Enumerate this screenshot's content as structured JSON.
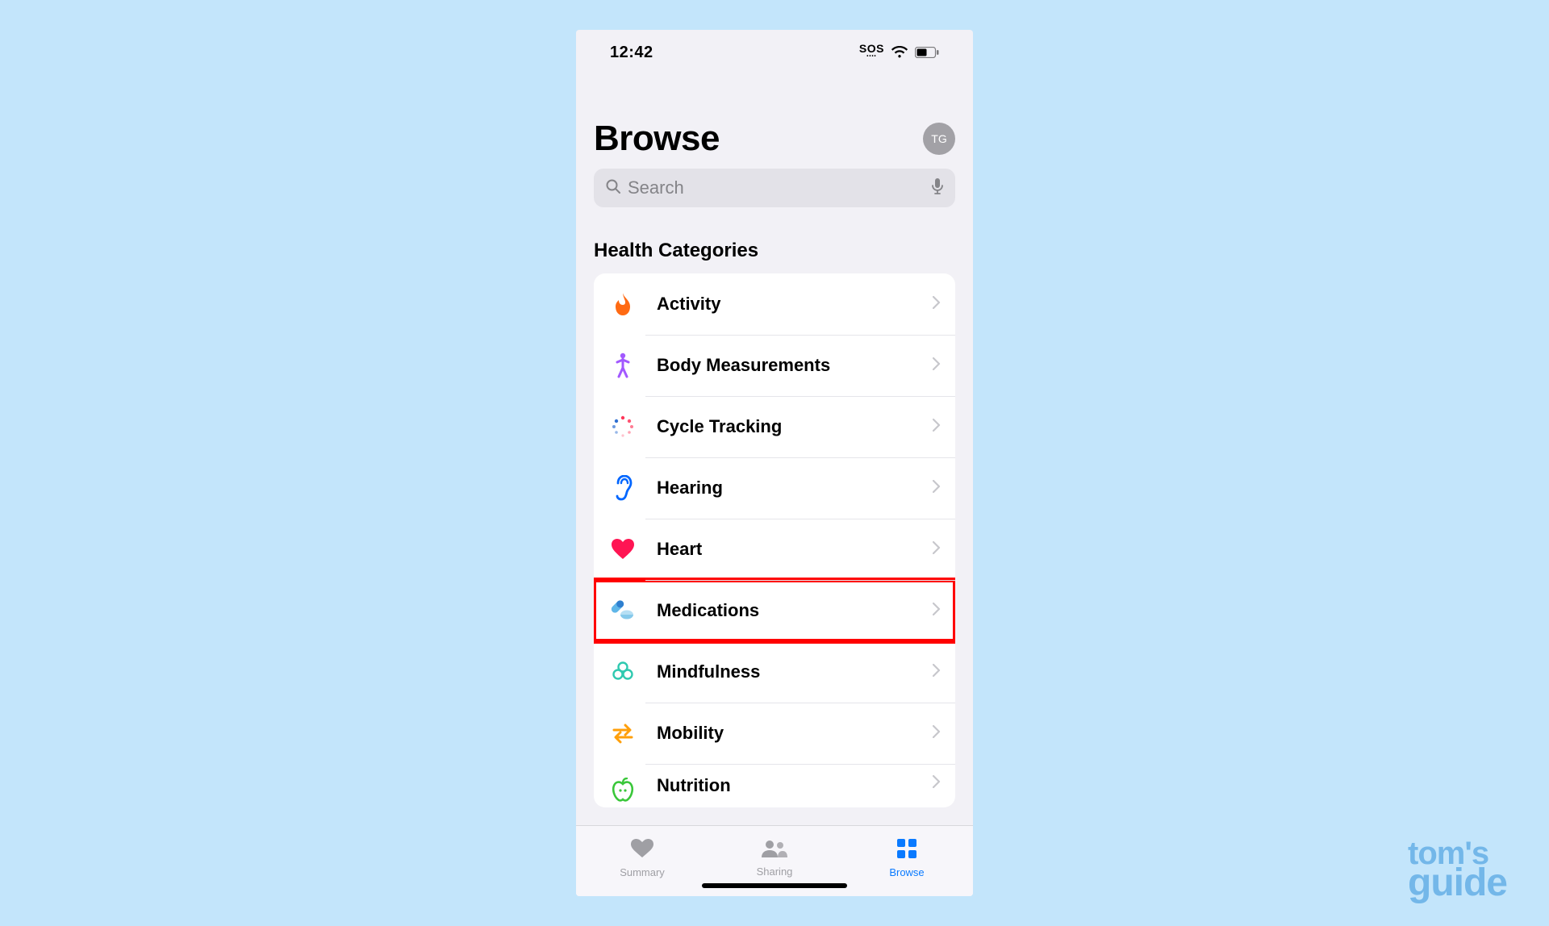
{
  "statusbar": {
    "time": "12:42",
    "sos": "SOS"
  },
  "header": {
    "title": "Browse",
    "avatar_initials": "TG"
  },
  "search": {
    "placeholder": "Search"
  },
  "section": {
    "title": "Health Categories"
  },
  "categories": [
    {
      "id": "activity",
      "label": "Activity",
      "icon": "flame-icon",
      "highlight": false
    },
    {
      "id": "body-measurements",
      "label": "Body Measurements",
      "icon": "body-icon",
      "highlight": false
    },
    {
      "id": "cycle-tracking",
      "label": "Cycle Tracking",
      "icon": "cycle-icon",
      "highlight": false
    },
    {
      "id": "hearing",
      "label": "Hearing",
      "icon": "ear-icon",
      "highlight": false
    },
    {
      "id": "heart",
      "label": "Heart",
      "icon": "heart-icon",
      "highlight": false
    },
    {
      "id": "medications",
      "label": "Medications",
      "icon": "pills-icon",
      "highlight": true
    },
    {
      "id": "mindfulness",
      "label": "Mindfulness",
      "icon": "mindfulness-icon",
      "highlight": false
    },
    {
      "id": "mobility",
      "label": "Mobility",
      "icon": "mobility-icon",
      "highlight": false
    },
    {
      "id": "nutrition",
      "label": "Nutrition",
      "icon": "nutrition-icon",
      "highlight": false
    }
  ],
  "tabs": {
    "summary": "Summary",
    "sharing": "Sharing",
    "browse": "Browse",
    "active": "browse"
  },
  "watermark": {
    "line1": "tom's",
    "line2": "guide"
  }
}
